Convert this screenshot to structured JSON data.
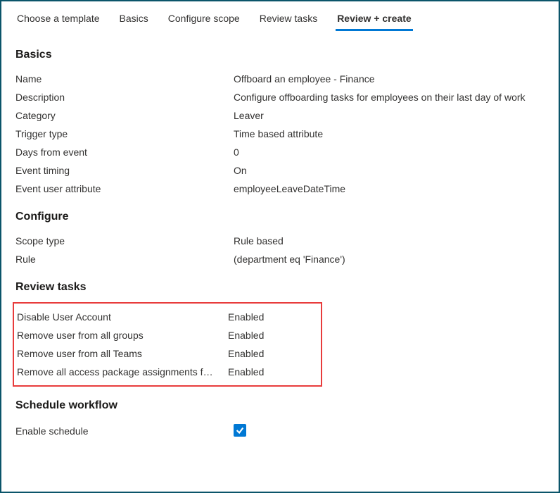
{
  "tabs": {
    "choose_template": "Choose a template",
    "basics": "Basics",
    "configure_scope": "Configure scope",
    "review_tasks": "Review tasks",
    "review_create": "Review + create"
  },
  "sections": {
    "basics": {
      "title": "Basics",
      "rows": {
        "name": {
          "label": "Name",
          "value": "Offboard an employee - Finance"
        },
        "description": {
          "label": "Description",
          "value": "Configure offboarding tasks for employees on their last day of work"
        },
        "category": {
          "label": "Category",
          "value": "Leaver"
        },
        "trigger_type": {
          "label": "Trigger type",
          "value": "Time based attribute"
        },
        "days_from_event": {
          "label": "Days from event",
          "value": "0"
        },
        "event_timing": {
          "label": "Event timing",
          "value": "On"
        },
        "event_user_attribute": {
          "label": "Event user attribute",
          "value": "employeeLeaveDateTime"
        }
      }
    },
    "configure": {
      "title": "Configure",
      "rows": {
        "scope_type": {
          "label": "Scope type",
          "value": "Rule based"
        },
        "rule": {
          "label": "Rule",
          "value": " (department eq 'Finance')"
        }
      }
    },
    "review_tasks": {
      "title": "Review tasks",
      "tasks": [
        {
          "label": "Disable User Account",
          "value": "Enabled"
        },
        {
          "label": "Remove user from all groups",
          "value": "Enabled"
        },
        {
          "label": "Remove user from all Teams",
          "value": "Enabled"
        },
        {
          "label": "Remove all access package assignments f…",
          "value": "Enabled"
        }
      ]
    },
    "schedule": {
      "title": "Schedule workflow",
      "rows": {
        "enable_schedule": {
          "label": "Enable schedule",
          "checked": true
        }
      }
    }
  }
}
